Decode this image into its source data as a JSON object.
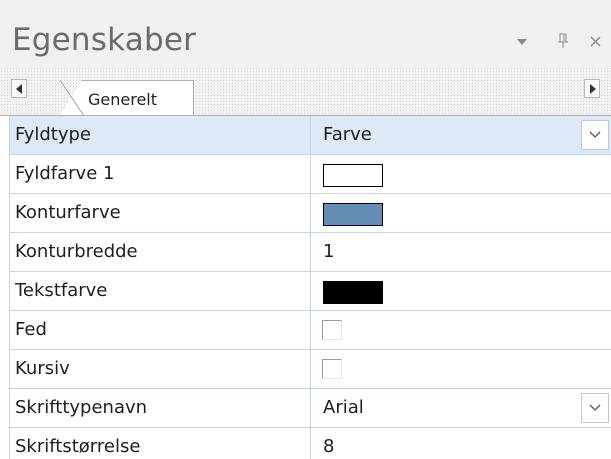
{
  "panel": {
    "title": "Egenskaber",
    "controls": {
      "dropdown_icon": "chevron-down-icon",
      "pin_glyph": "ѹ",
      "close_glyph": "×"
    }
  },
  "tabs": [
    {
      "label": "Generelt",
      "active": true
    }
  ],
  "properties": [
    {
      "name": "Fyldtype",
      "type": "dropdown",
      "value": "Farve"
    },
    {
      "name": "Fyldfarve 1",
      "type": "color",
      "color": "#ffffff"
    },
    {
      "name": "Konturfarve",
      "type": "color",
      "color": "#658cb2"
    },
    {
      "name": "Konturbredde",
      "type": "text",
      "value": "1"
    },
    {
      "name": "Tekstfarve",
      "type": "color",
      "color": "#000000"
    },
    {
      "name": "Fed",
      "type": "checkbox",
      "checked": false
    },
    {
      "name": "Kursiv",
      "type": "checkbox",
      "checked": false
    },
    {
      "name": "Skrifttypenavn",
      "type": "dropdown",
      "value": "Arial"
    },
    {
      "name": "Skriftstørrelse",
      "type": "text",
      "value": "8"
    }
  ],
  "colors": {
    "selected_row": "#dde9f7",
    "grid_line": "#c5d5ea"
  }
}
